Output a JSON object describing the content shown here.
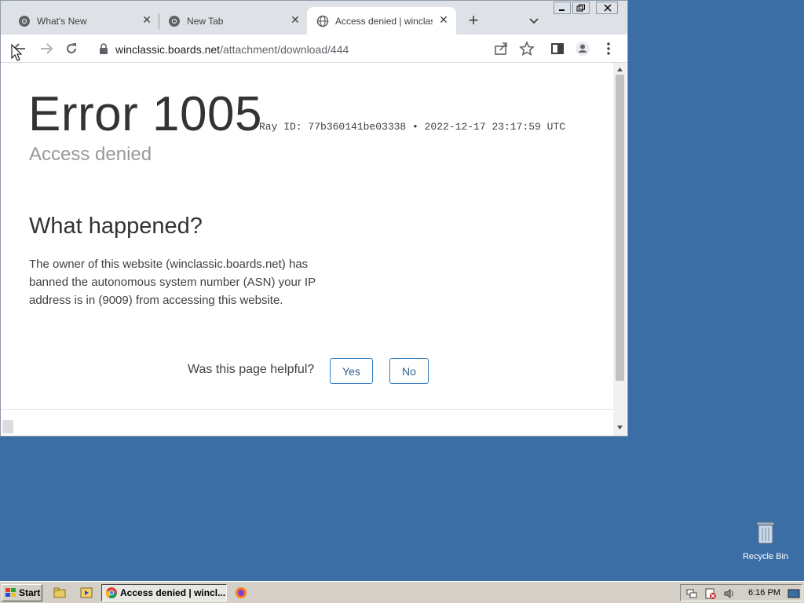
{
  "browser": {
    "tabs": [
      {
        "title": "What's New",
        "active": false,
        "icon": "chrome-icon"
      },
      {
        "title": "New Tab",
        "active": false,
        "icon": "chrome-icon"
      },
      {
        "title": "Access denied | winclassic",
        "active": true,
        "icon": "globe-icon"
      }
    ],
    "url": {
      "host": "winclassic.boards.net",
      "path": "/attachment/download/444"
    }
  },
  "page": {
    "error_code": "Error 1005",
    "ray_id": "Ray ID: 77b360141be03338 • 2022-12-17 23:17:59 UTC",
    "subtitle": "Access denied",
    "what_heading": "What happened?",
    "explanation": "The owner of this website (winclassic.boards.net) has banned the autonomous system number (ASN) your IP address is in (9009) from accessing this website.",
    "feedback_question": "Was this page helpful?",
    "yes_label": "Yes",
    "no_label": "No"
  },
  "desktop": {
    "recycle_bin_label": "Recycle Bin"
  },
  "taskbar": {
    "start_label": "Start",
    "task_label": "Access denied | wincl...",
    "clock": "6:16 PM"
  },
  "colors": {
    "desktop": "#3a6ea5",
    "button_border": "#2f7bbf",
    "taskbar": "#d4d0c8"
  }
}
